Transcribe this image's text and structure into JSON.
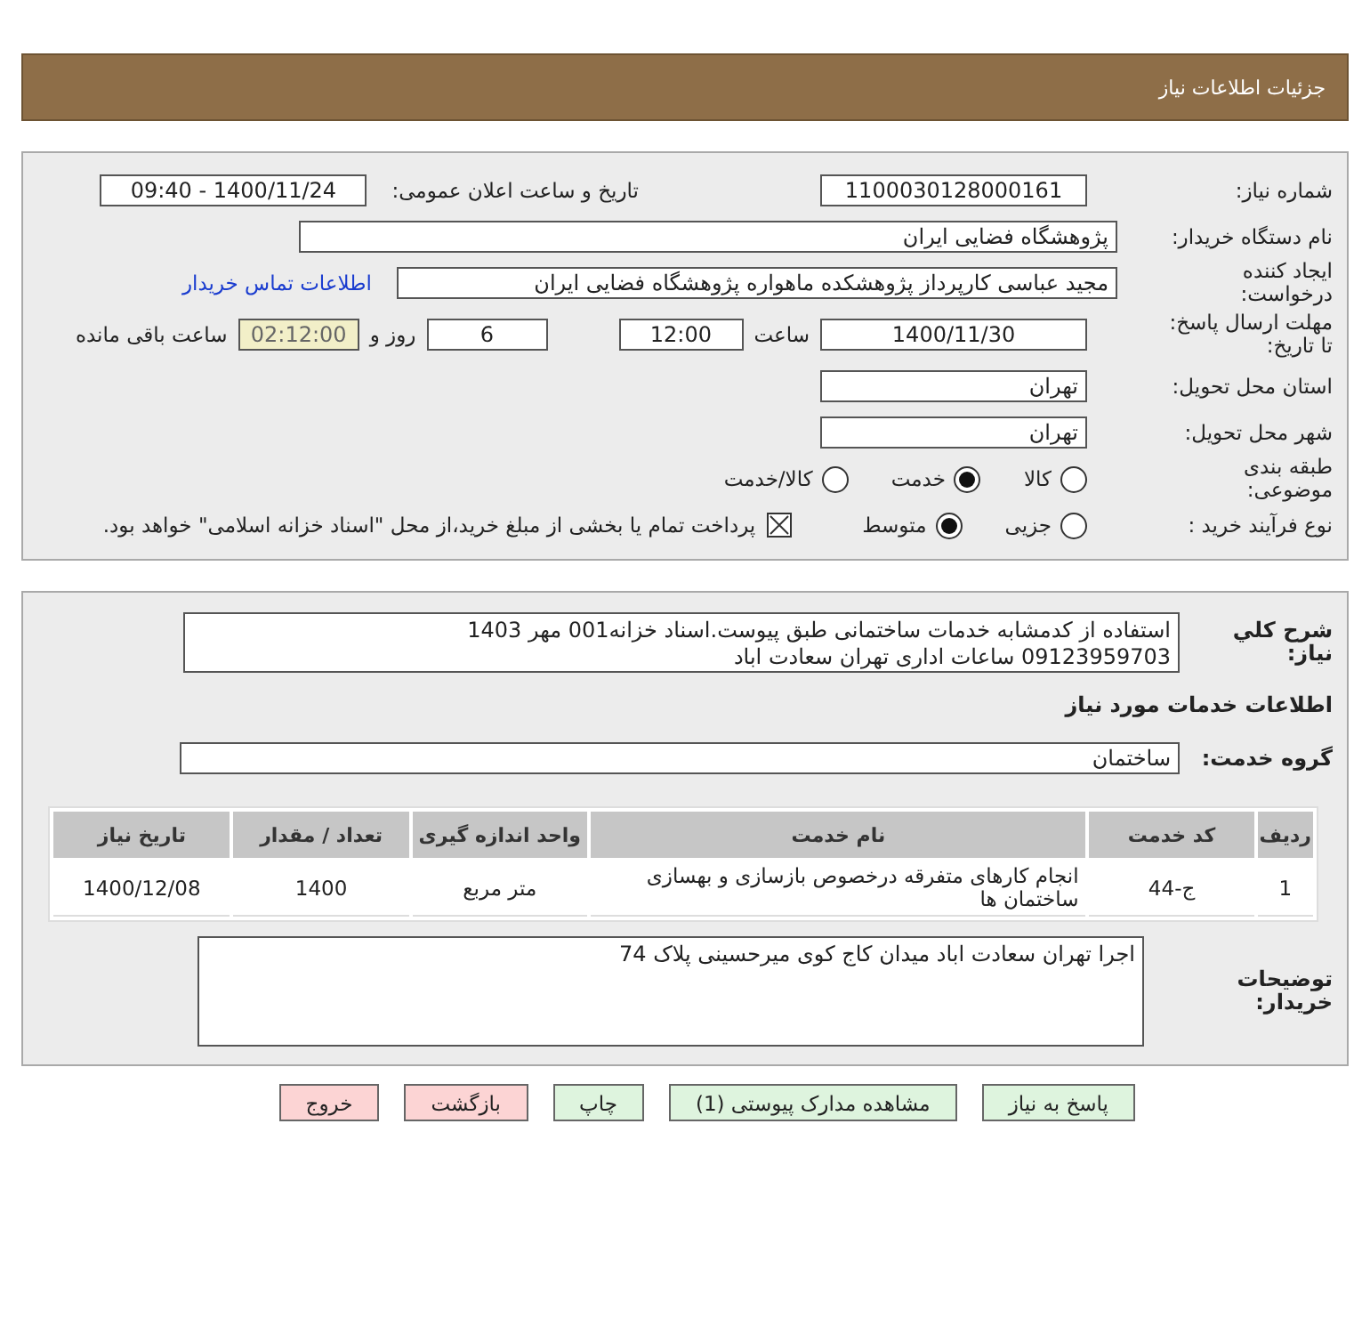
{
  "header": {
    "title": "جزئیات اطلاعات نیاز"
  },
  "need_number": {
    "label": "شماره نیاز:",
    "value": "1100030128000161"
  },
  "announce": {
    "label": "تاریخ و ساعت اعلان عمومی:",
    "value": "1400/11/24 - 09:40"
  },
  "buyer_org": {
    "label": "نام دستگاه خریدار:",
    "value": "پژوهشگاه فضایی ایران"
  },
  "requester": {
    "label": "ایجاد کننده درخواست:",
    "value": "مجید عباسی کارپرداز پژوهشکده ماهواره پژوهشگاه فضایی ایران",
    "link": "اطلاعات تماس خریدار"
  },
  "deadline": {
    "label": "مهلت ارسال پاسخ: تا تاریخ:",
    "date": "1400/11/30",
    "time_label": "ساعت",
    "time": "12:00",
    "days": "6",
    "days_label": "روز و",
    "remaining": "02:12:00",
    "remaining_label": "ساعت باقی مانده"
  },
  "province": {
    "label": "استان محل تحویل:",
    "value": "تهران"
  },
  "city": {
    "label": "شهر محل تحویل:",
    "value": "تهران"
  },
  "category": {
    "label": "طبقه بندی موضوعی:",
    "options": [
      {
        "label": "کالا",
        "selected": false
      },
      {
        "label": "خدمت",
        "selected": true
      },
      {
        "label": "کالا/خدمت",
        "selected": false
      }
    ]
  },
  "purchase_type": {
    "label": "نوع فرآیند خرید :",
    "options": [
      {
        "label": "جزیی",
        "selected": false
      },
      {
        "label": "متوسط",
        "selected": true
      }
    ],
    "payment": {
      "label": "پرداخت تمام یا بخشی از مبلغ خرید،از محل \"اسناد خزانه اسلامی\" خواهد بود.",
      "checked": true
    }
  },
  "description": {
    "label": "شرح کلي نياز:",
    "lines": [
      "استفاده از کدمشابه خدمات ساختمانی طبق پیوست.اسناد خزانه001 مهر 1403",
      "09123959703 ساعات اداری تهران سعادت اباد"
    ]
  },
  "services_heading": "اطلاعات خدمات مورد نیاز",
  "service_group": {
    "label": "گروه خدمت:",
    "value": "ساختمان"
  },
  "table": {
    "columns": [
      "ردیف",
      "کد خدمت",
      "نام خدمت",
      "واحد اندازه گیری",
      "تعداد / مقدار",
      "تاریخ نیاز"
    ],
    "rows": [
      [
        "1",
        "ج-44",
        "انجام کارهای متفرقه درخصوص بازسازی و بهسازی ساختمان ها",
        "متر مربع",
        "1400",
        "1400/12/08"
      ]
    ]
  },
  "buyer_notes": {
    "label": "توضیحات خریدار:",
    "value": "اجرا تهران سعادت اباد میدان کاج کوی میرحسینی پلاک 74"
  },
  "buttons": [
    {
      "label": "پاسخ به نیاز",
      "kind": "primary"
    },
    {
      "label": "مشاهده مدارک پیوستی (1)",
      "kind": "primary"
    },
    {
      "label": "چاپ",
      "kind": "primary"
    },
    {
      "label": "بازگشت",
      "kind": "danger"
    },
    {
      "label": "خروج",
      "kind": "danger"
    }
  ]
}
